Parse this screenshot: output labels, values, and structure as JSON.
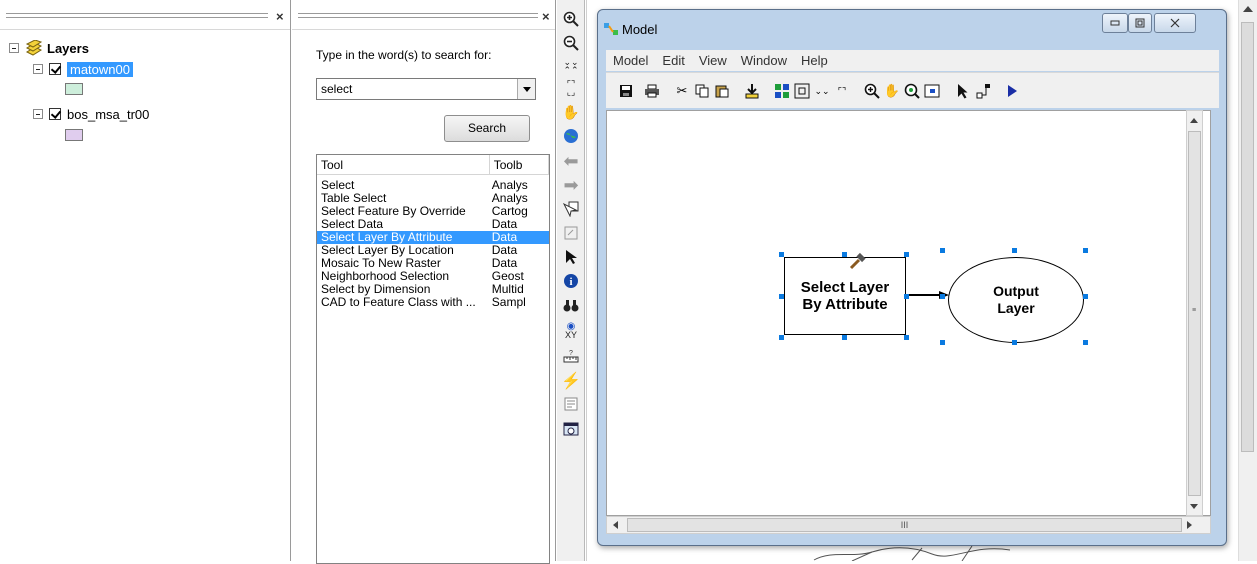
{
  "toc": {
    "root_label": "Layers",
    "layers": [
      {
        "name": "matown00",
        "checked": true,
        "selected": true,
        "swatch": "#cdeedb"
      },
      {
        "name": "bos_msa_tr00",
        "checked": true,
        "selected": false,
        "swatch": "#e0cdee"
      }
    ]
  },
  "search": {
    "prompt": "Type in the word(s) to search for:",
    "query": "select",
    "search_button": "Search",
    "columns": [
      "Tool",
      "Toolb"
    ],
    "results": [
      {
        "tool": "Select",
        "toolbox": "Analys"
      },
      {
        "tool": "Table Select",
        "toolbox": "Analys"
      },
      {
        "tool": "Select Feature By Override",
        "toolbox": "Cartog"
      },
      {
        "tool": "Select Data",
        "toolbox": "Data"
      },
      {
        "tool": "Select Layer By Attribute",
        "toolbox": "Data",
        "selected": true
      },
      {
        "tool": "Select Layer By Location",
        "toolbox": "Data"
      },
      {
        "tool": "Mosaic To New Raster",
        "toolbox": "Data"
      },
      {
        "tool": "Neighborhood Selection",
        "toolbox": "Geost"
      },
      {
        "tool": "Select by Dimension",
        "toolbox": "Multid"
      },
      {
        "tool": "CAD to Feature Class with ...",
        "toolbox": "Sampl"
      }
    ]
  },
  "tools_bar": [
    "zoom-in-icon",
    "zoom-out-icon",
    "fixed-zoom-in-icon",
    "fixed-zoom-out-icon",
    "pan-icon",
    "full-extent-icon",
    "back-icon",
    "forward-icon",
    "select-features-icon",
    "clear-selection-icon",
    "select-elements-icon",
    "identify-icon",
    "find-icon",
    "go-to-xy-icon",
    "measure-icon",
    "hyperlink-icon",
    "html-popup-icon",
    "time-slider-icon"
  ],
  "model": {
    "title": "Model",
    "menus": [
      "Model",
      "Edit",
      "View",
      "Window",
      "Help"
    ],
    "tool_box_label": "Select Layer By Attribute",
    "tool_box_lines": [
      "Select Layer",
      "By Attribute"
    ],
    "output_lines": [
      "Output",
      "Layer"
    ],
    "colors": {
      "window_frame": "#bcd2ea",
      "handle": "#0a7ae0",
      "selection": "#3399ff"
    },
    "scroll_glyph": "III"
  }
}
